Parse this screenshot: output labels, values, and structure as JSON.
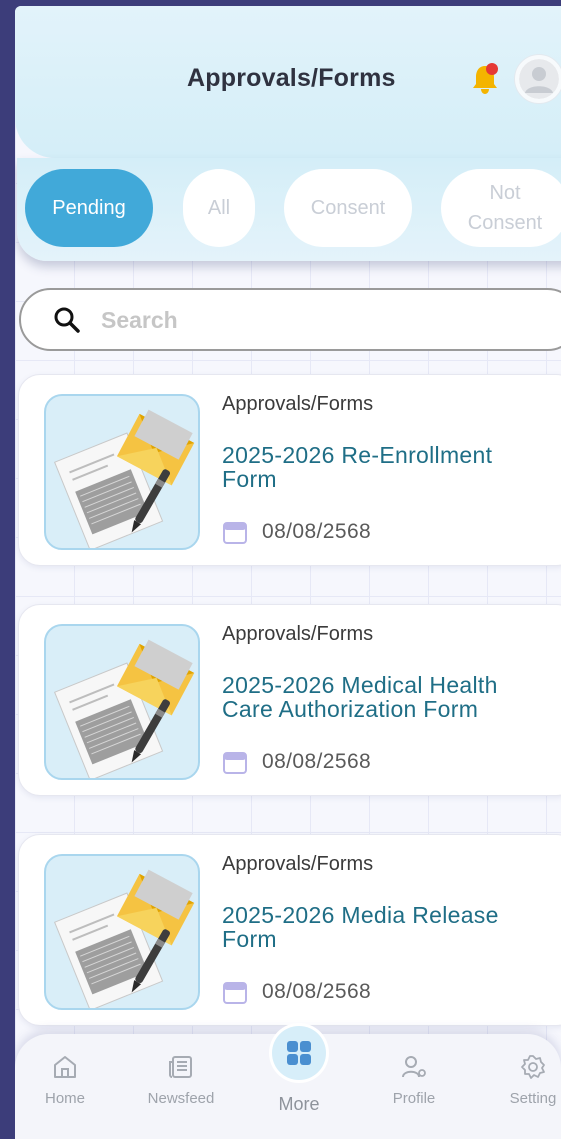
{
  "header": {
    "title": "Approvals/Forms",
    "notification_dot_color": "#e53935"
  },
  "tabs": [
    {
      "label": "Pending",
      "active": true
    },
    {
      "label": "All",
      "active": false
    },
    {
      "label": "Consent",
      "active": false
    },
    {
      "label": "Not\nConsent",
      "active": false
    }
  ],
  "search": {
    "placeholder": "Search",
    "value": ""
  },
  "cards": [
    {
      "category": "Approvals/Forms",
      "title": "2025-2026 Re-Enrollment Form",
      "date": "08/08/2568"
    },
    {
      "category": "Approvals/Forms",
      "title": "2025-2026 Medical Health Care Authorization Form",
      "date": "08/08/2568"
    },
    {
      "category": "Approvals/Forms",
      "title": "2025-2026 Media Release Form",
      "date": "08/08/2568"
    }
  ],
  "bottom_nav": {
    "home": "Home",
    "newsfeed": "Newsfeed",
    "more": "More",
    "profile": "Profile",
    "setting": "Setting"
  },
  "colors": {
    "accent": "#41a9d9",
    "card_title": "#1f6e86",
    "background": "#3c3d7a"
  }
}
